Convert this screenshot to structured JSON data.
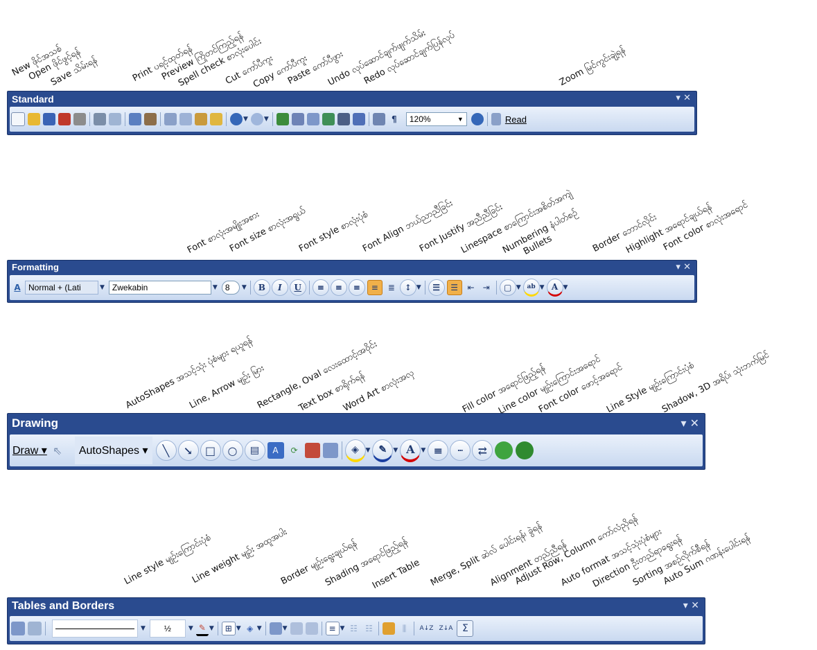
{
  "standard": {
    "labels": [
      "New ဖိုင်အသစ်",
      "Open ဖိုင်ဖွင့်ရန်",
      "Save သိမ်းရန်",
      "Print ပရင့်ထုတ်ရန်",
      "Preview ကြိုတင်ကြည့်ရန်",
      "Spell check စာလုံးပေါင်း",
      "Cut ကော်ပီကူး",
      "Copy ကော်ပီကူး",
      "Paste ကော်ပီဖွား",
      "Undo လုပ်ဆောင်ချက်ဖျက်သိမ်း",
      "Redo လုပ်ဆောင်ချက်ပြန်လုပ်",
      "Zoom မြင်ကွင်းချဲ့ရန်"
    ],
    "title": "Standard",
    "zoom_value": "120%",
    "read_label": "Read",
    "pilcrow": "¶"
  },
  "formatting": {
    "labels": [
      "Font စာလုံးအမျိုးအစား",
      "Font size စာလုံးအရွယ်",
      "Font style စာလုံးပုံစံ",
      "Font Align ဘယ်ညာညီခြင်း",
      "Font Justify အညီညီခြင်း",
      "Linespace စာကြောင်းအစိတ်အကျဲ",
      "Numbering နံပါတ်စဉ်",
      "Bullets",
      "Border ဘောင်လိုင်း",
      "Highlight အရောင်ချယ်ရန်",
      "Font color စာလုံးအရောင်"
    ],
    "title": "Formatting",
    "style_value": "Normal + (Lati",
    "font_value": "Zwekabin",
    "size_value": "8",
    "bold": "B",
    "italic": "I",
    "underline": "U",
    "highlight_glyph": "ab",
    "fontcolor_glyph": "A"
  },
  "drawing": {
    "labels": [
      "AutoShapes အသင့်သုံး ပုံစံများ ရယူရန်",
      "Line, Arrow မျဉ်း မြား",
      "Rectangle, Oval လေးထောင့်၊အဝိုင်း",
      "Text box စာရိုက်ရန်",
      "Word Art စာလုံးအလှ",
      "Fill color အရောင်ဖြည့်ရန်",
      "Line color မျဉ်းကြောင်းအရောင်",
      "Font color ဖောင့်အရောင်",
      "Line Style မျဉ်းကြောင်းပုံစံ",
      "Shadow, 3D အရိပ်၊ သုံးဘက်မြင်"
    ],
    "title": "Drawing",
    "draw_label": "Draw",
    "autoshapes_label": "AutoShapes",
    "fontcolor_glyph": "A"
  },
  "tables": {
    "labels": [
      "Line style မျဉ်းကြောင်းပုံစံ",
      "Line weight မျဉ်း အထူအပါး",
      "Border မျဉ်းရွေးချယ်ရန်",
      "Shading အရောင်ဖြည့်ရန်",
      "Insert Table",
      "Merge, Split ဆဲလ် ပေါင်းရန်၊ ခွဲရန်",
      "Alignment တည်ညီရန်",
      "Adjust Row, Column ကော်လံညှိရန်",
      "Auto format အသင့်သုံးပုံစံများ",
      "Direction ဦးတည်ရာရွေးရန်",
      "Sorting အစဉ်လိုက်စီရန်",
      "Auto Sum ဂဏန်းပေါင်းရန်"
    ],
    "title": "Tables and Borders",
    "weight_value": "½",
    "sum_glyph": "Σ",
    "sort_az": "A↓Z",
    "sort_za": "Z↓A"
  },
  "window": {
    "collapse": "▾",
    "close": "✕"
  }
}
